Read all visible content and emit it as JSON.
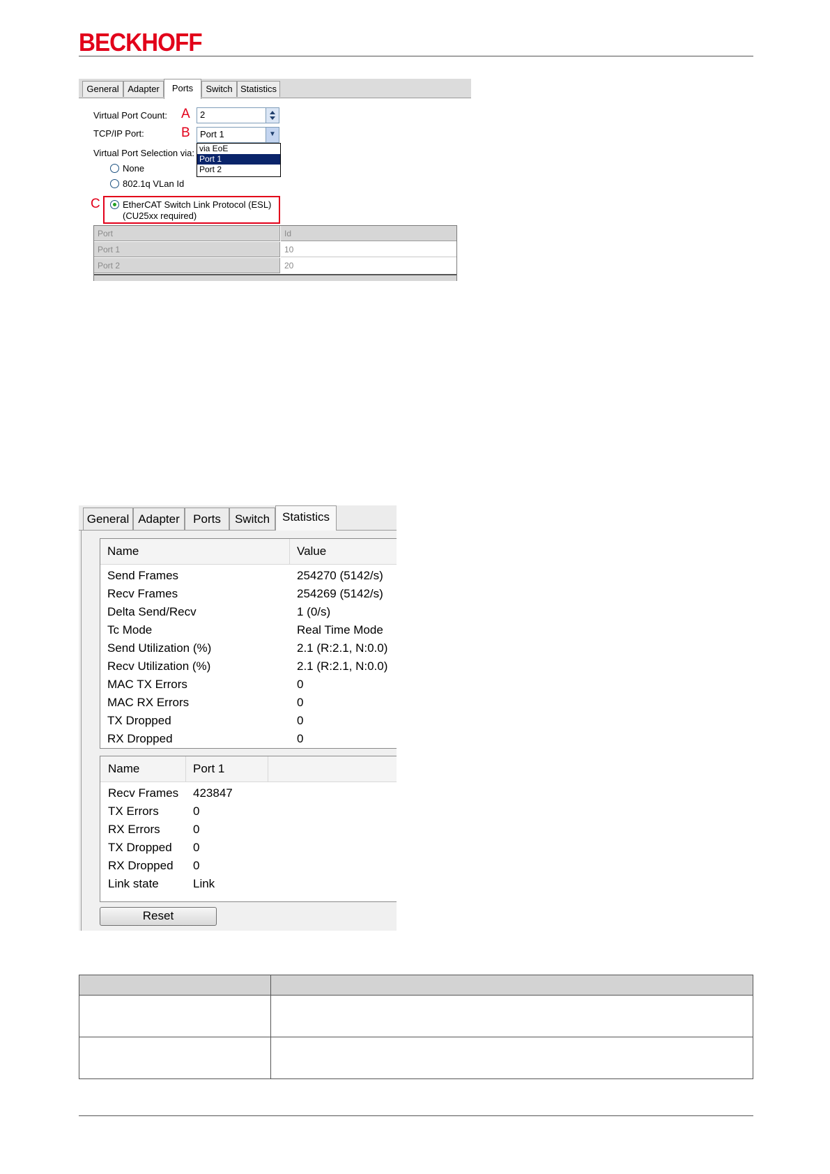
{
  "header": {
    "logo_text": "BECKHOFF",
    "brand_color": "#e2001a"
  },
  "ports_dialog": {
    "tabs": [
      "General",
      "Adapter",
      "Ports",
      "Switch",
      "Statistics"
    ],
    "active_tab": "Ports",
    "virtual_port_count": {
      "label": "Virtual Port Count:",
      "marker": "A",
      "value": "2"
    },
    "tcpip_port": {
      "label": "TCP/IP Port:",
      "marker": "B",
      "value": "Port 1",
      "options": [
        "via EoE",
        "Port 1",
        "Port 2"
      ],
      "selected_option": "Port 1"
    },
    "selection_label": "Virtual Port Selection via:",
    "radio_options": [
      {
        "label": "None",
        "checked": false
      },
      {
        "label": "802.1q VLan Id",
        "checked": false
      },
      {
        "label": "EtherCAT Switch Link Protocol (ESL)",
        "sublabel": "(CU25xx required)",
        "checked": true
      }
    ],
    "marker_c": "C",
    "grid": {
      "headers": [
        "Port",
        "Id"
      ],
      "rows": [
        [
          "Port 1",
          "10"
        ],
        [
          "Port 2",
          "20"
        ]
      ]
    }
  },
  "stats_dialog": {
    "tabs": [
      "General",
      "Adapter",
      "Ports",
      "Switch",
      "Statistics"
    ],
    "active_tab": "Statistics",
    "table1": {
      "headers": [
        "Name",
        "Value"
      ],
      "rows": [
        [
          "Send Frames",
          "254270 (5142/s)"
        ],
        [
          "Recv Frames",
          "254269 (5142/s)"
        ],
        [
          "Delta Send/Recv",
          "1 (0/s)"
        ],
        [
          "Tc Mode",
          "Real Time Mode"
        ],
        [
          "Send Utilization (%)",
          "2.1 (R:2.1, N:0.0)"
        ],
        [
          "Recv Utilization (%)",
          "2.1 (R:2.1, N:0.0)"
        ],
        [
          "MAC TX Errors",
          "0"
        ],
        [
          "MAC RX Errors",
          "0"
        ],
        [
          "TX Dropped",
          "0"
        ],
        [
          "RX Dropped",
          "0"
        ]
      ]
    },
    "table2": {
      "headers": [
        "Name",
        "Port 1"
      ],
      "rows": [
        [
          "Recv Frames",
          "423847"
        ],
        [
          "TX Errors",
          "0"
        ],
        [
          "RX Errors",
          "0"
        ],
        [
          "TX Dropped",
          "0"
        ],
        [
          "RX Dropped",
          "0"
        ],
        [
          "Link state",
          "Link"
        ]
      ]
    },
    "reset_label": "Reset"
  }
}
